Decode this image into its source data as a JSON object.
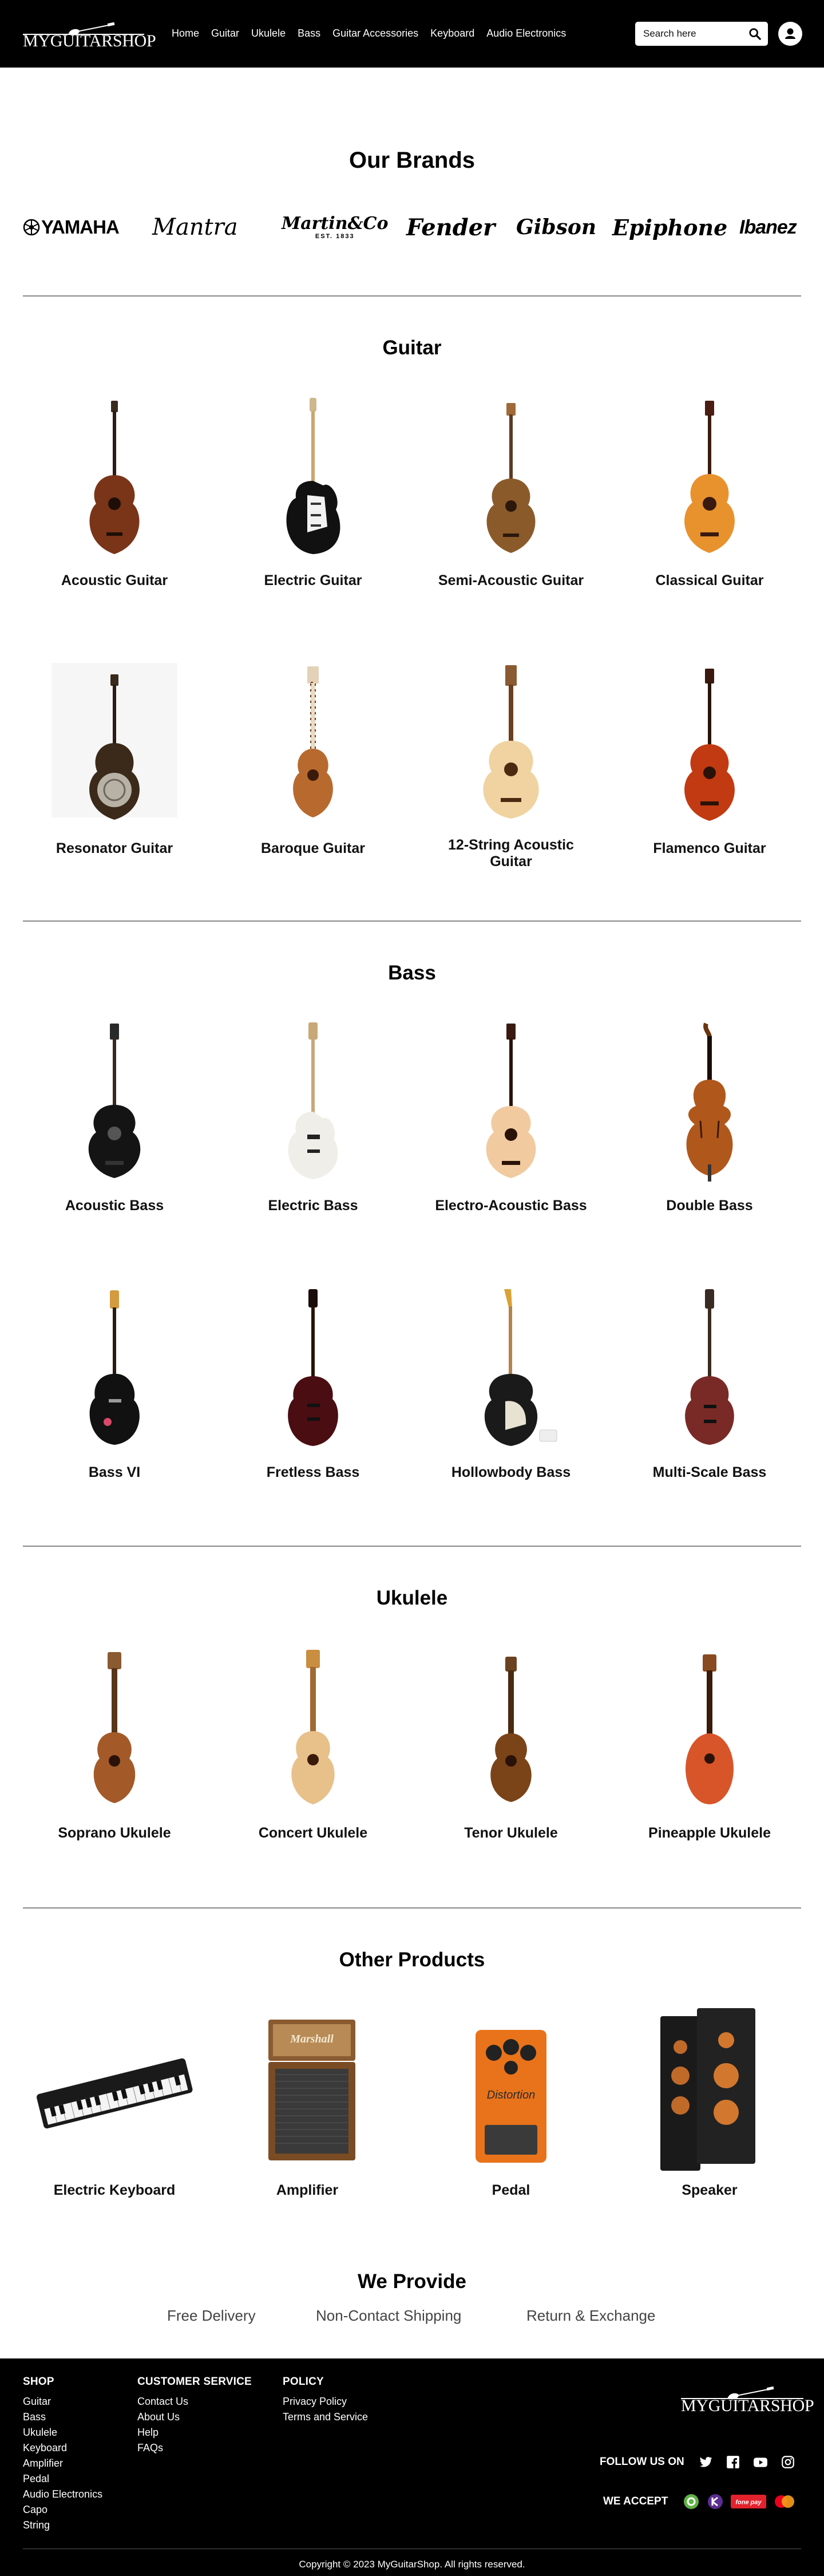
{
  "header": {
    "logo_text": "MYGUITARSHOP",
    "nav": [
      "Home",
      "Guitar",
      "Ukulele",
      "Bass",
      "Guitar Accessories",
      "Keyboard",
      "Audio Electronics"
    ],
    "search_placeholder": "Search here"
  },
  "brands": {
    "title": "Our Brands",
    "items": [
      "YAMAHA",
      "Mantra",
      "Martin&Co",
      "Fender",
      "Gibson",
      "Epiphone",
      "Ibanez"
    ],
    "martin_sub": "EST. 1833"
  },
  "guitar": {
    "title": "Guitar",
    "items": [
      "Acoustic Guitar",
      "Electric Guitar",
      "Semi-Acoustic Guitar",
      "Classical Guitar",
      "Resonator Guitar",
      "Baroque Guitar",
      "12-String Acoustic Guitar",
      "Flamenco Guitar"
    ]
  },
  "bass": {
    "title": "Bass",
    "items": [
      "Acoustic Bass",
      "Electric Bass",
      "Electro-Acoustic Bass",
      "Double Bass",
      "Bass VI",
      "Fretless Bass",
      "Hollowbody Bass",
      "Multi-Scale Bass"
    ]
  },
  "ukulele": {
    "title": "Ukulele",
    "items": [
      "Soprano Ukulele",
      "Concert Ukulele",
      "Tenor Ukulele",
      "Pineapple Ukulele"
    ]
  },
  "other": {
    "title": "Other Products",
    "items": [
      "Electric Keyboard",
      "Amplifier",
      "Pedal",
      "Speaker"
    ],
    "amp_brand": "Marshall",
    "pedal_text": "Distortion"
  },
  "provide": {
    "title": "We Provide",
    "items": [
      "Free Delivery",
      "Non-Contact Shipping",
      "Return & Exchange"
    ]
  },
  "footer": {
    "shop_title": "SHOP",
    "shop_links": [
      "Guitar",
      "Bass",
      "Ukulele",
      "Keyboard",
      "Amplifier",
      "Pedal",
      "Audio Electronics",
      "Capo",
      "String"
    ],
    "service_title": "CUSTOMER SERVICE",
    "service_links": [
      "Contact Us",
      "About Us",
      "Help",
      "FAQs"
    ],
    "policy_title": "POLICY",
    "policy_links": [
      "Privacy Policy",
      "Terms and Service"
    ],
    "logo_text": "MYGUITARSHOP",
    "follow_label": "FOLLOW US ON",
    "social_icons": [
      "twitter-icon",
      "facebook-icon",
      "youtube-icon",
      "instagram-icon"
    ],
    "accept_label": "WE ACCEPT",
    "payment_icons": [
      "esewa-icon",
      "khalti-icon",
      "fonepay-icon",
      "mastercard-icon"
    ],
    "fonepay_text": "fone pay",
    "copyright": "Copyright © 2023 MyGuitarShop. All rights reserved."
  }
}
